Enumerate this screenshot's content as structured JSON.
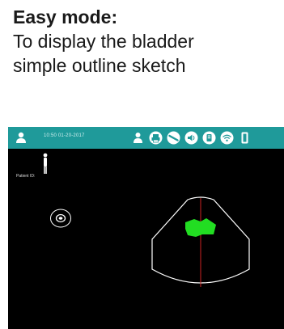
{
  "caption": {
    "title": "Easy mode:",
    "line1": "To display the bladder",
    "line2": "simple outline sketch"
  },
  "device": {
    "topbar": {
      "datetime": "10:50 01-20-2017",
      "icons": [
        "user-icon",
        "printer-icon",
        "probe-icon",
        "volume-icon",
        "storage-icon",
        "wifi-icon",
        "battery-icon"
      ]
    },
    "patient_id_label": "Patient ID:",
    "colors": {
      "topbar": "#1f9a9a",
      "screen": "#000000",
      "bladder": "#22dd22",
      "centerline": "#cc2222"
    }
  }
}
